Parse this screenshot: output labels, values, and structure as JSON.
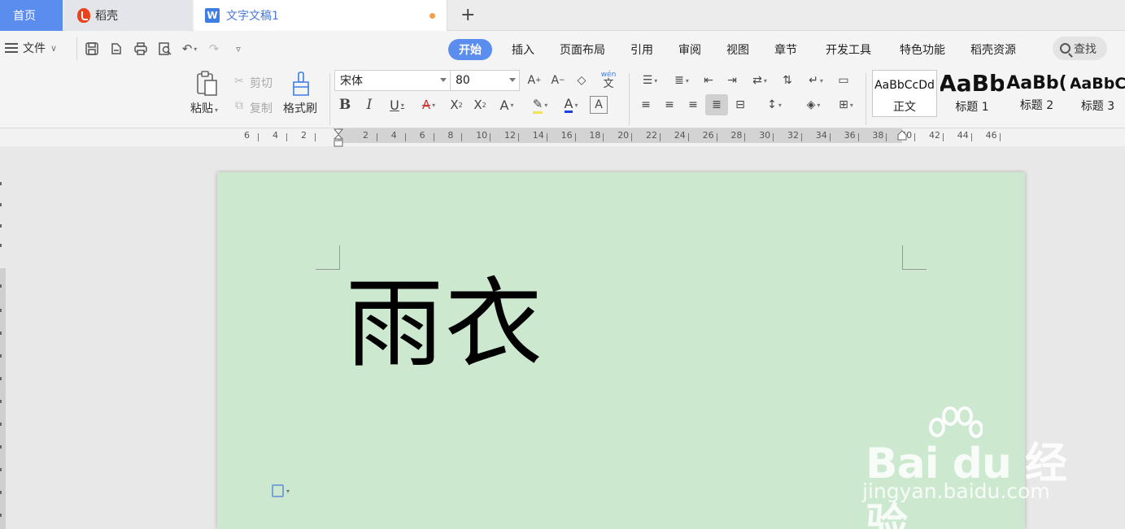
{
  "tabs": {
    "home": "首页",
    "docer": "稻壳",
    "document": "文字文稿1",
    "new_tab": "+"
  },
  "menu": {
    "file": "文件",
    "tabs": [
      "开始",
      "插入",
      "页面布局",
      "引用",
      "审阅",
      "视图",
      "章节",
      "开发工具",
      "特色功能",
      "稻壳资源"
    ],
    "search": "查找"
  },
  "ribbon": {
    "paste": "粘贴",
    "cut": "剪切",
    "copy": "复制",
    "format_painter": "格式刷",
    "font_name": "宋体",
    "font_size": "80",
    "pinyin": "wén",
    "styles": [
      {
        "sample": "AaBbCcDd",
        "name": "正文"
      },
      {
        "sample": "AaBb",
        "name": "标题 1"
      },
      {
        "sample": "AaBb(",
        "name": "标题 2"
      },
      {
        "sample": "AaBbC",
        "name": "标题 3"
      }
    ]
  },
  "ruler": {
    "labels": [
      "6",
      "4",
      "2",
      "2",
      "4",
      "6",
      "8",
      "10",
      "12",
      "14",
      "16",
      "18",
      "20",
      "22",
      "24",
      "26",
      "28",
      "30",
      "32",
      "34",
      "36",
      "38",
      "40",
      "42",
      "44",
      "46"
    ]
  },
  "document": {
    "text": "雨衣"
  },
  "watermark": {
    "brand": "Bai du 经验",
    "url": "jingyan.baidu.com"
  },
  "colors": {
    "accent": "#5b8def",
    "page_background": "#cce8cf",
    "docer_red": "#e8431e"
  }
}
